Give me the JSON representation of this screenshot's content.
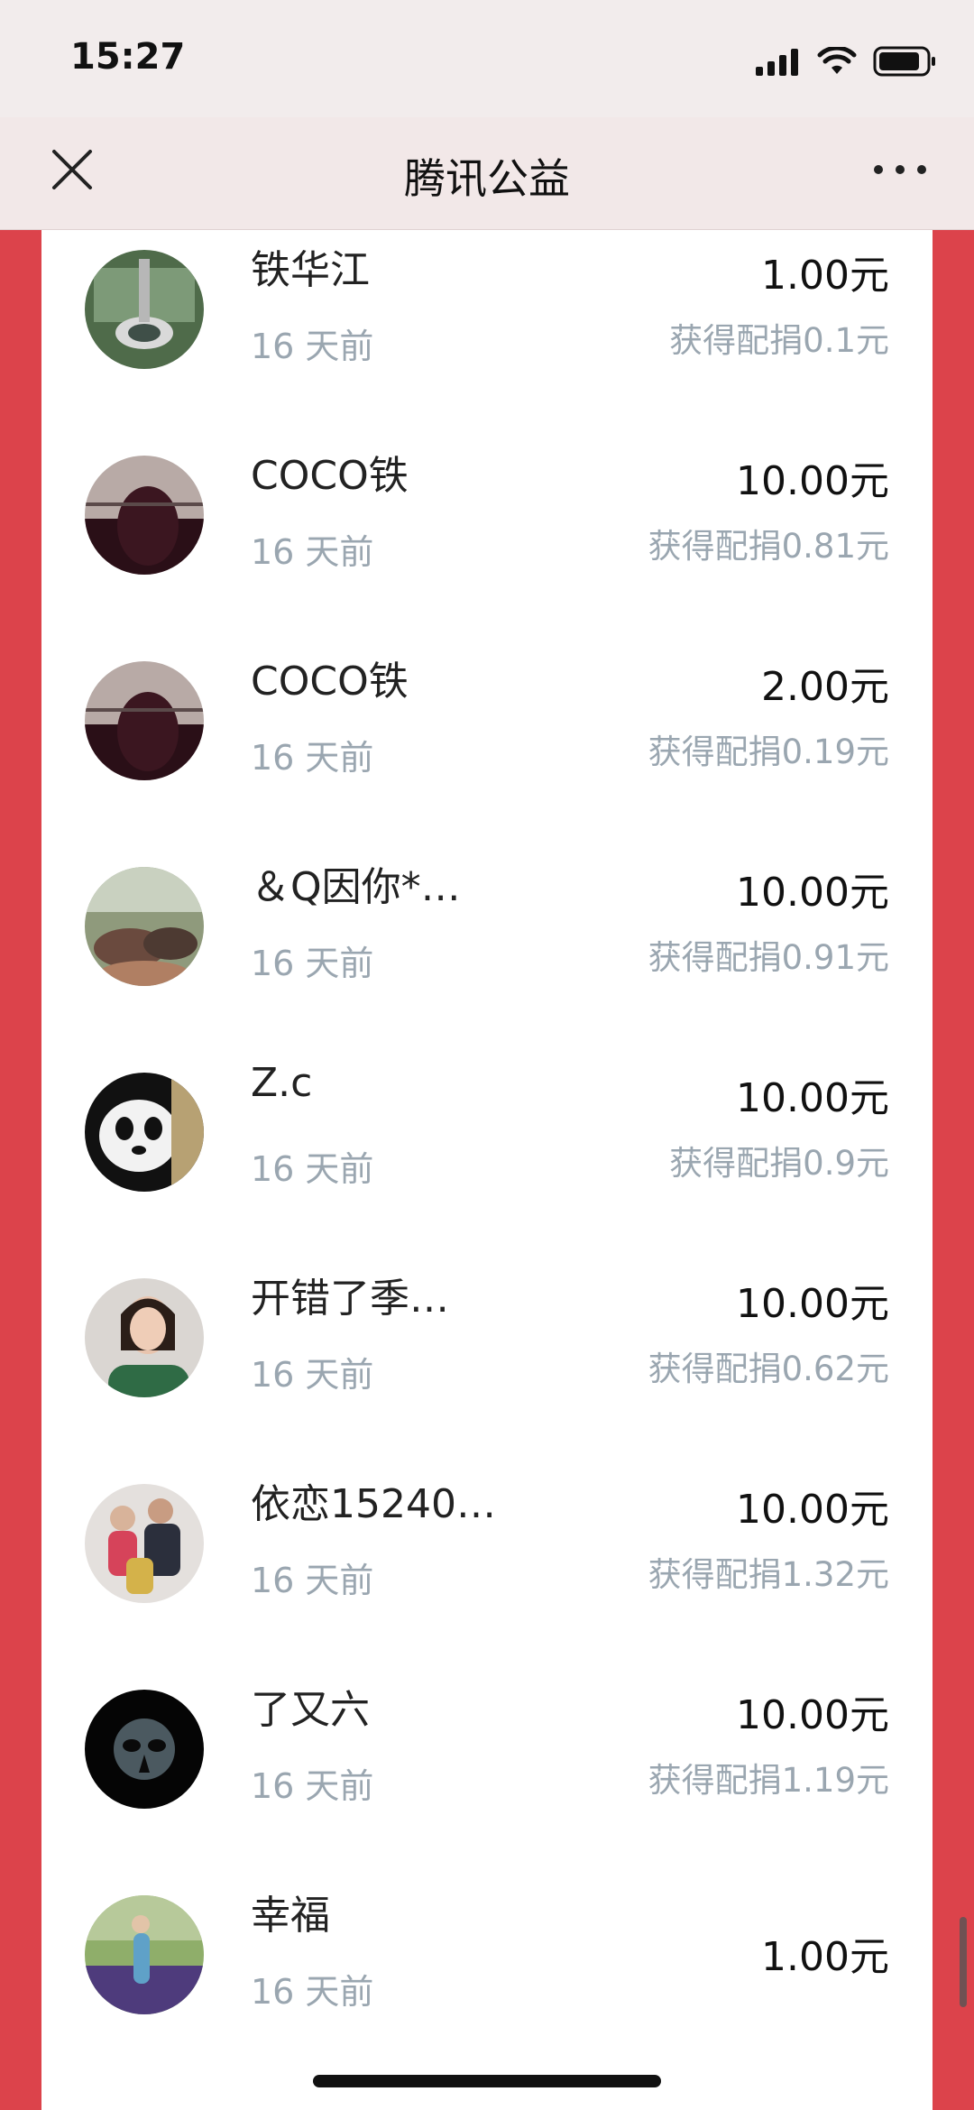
{
  "status_bar": {
    "time": "15:27"
  },
  "nav": {
    "title": "腾讯公益"
  },
  "donors": [
    {
      "name": "铁华江",
      "time": "16 天前",
      "amount": "1.00元",
      "match": "获得配捐0.1元"
    },
    {
      "name": "COCO铁",
      "time": "16 天前",
      "amount": "10.00元",
      "match": "获得配捐0.81元"
    },
    {
      "name": "COCO铁",
      "time": "16 天前",
      "amount": "2.00元",
      "match": "获得配捐0.19元"
    },
    {
      "name": "＆Q因你*…",
      "time": "16 天前",
      "amount": "10.00元",
      "match": "获得配捐0.91元"
    },
    {
      "name": "Z.c",
      "time": "16 天前",
      "amount": "10.00元",
      "match": "获得配捐0.9元"
    },
    {
      "name": "开错了季…",
      "time": "16 天前",
      "amount": "10.00元",
      "match": "获得配捐0.62元"
    },
    {
      "name": "依恋15240…",
      "time": "16 天前",
      "amount": "10.00元",
      "match": "获得配捐1.32元"
    },
    {
      "name": "了又六",
      "time": "16 天前",
      "amount": "10.00元",
      "match": "获得配捐1.19元"
    },
    {
      "name": "幸福",
      "time": "16 天前",
      "amount": "1.00元",
      "match": ""
    }
  ],
  "colors": {
    "page_bg": "#dc434b",
    "nav_bg": "#f2e8e8",
    "muted_text": "#9aa6b0"
  }
}
